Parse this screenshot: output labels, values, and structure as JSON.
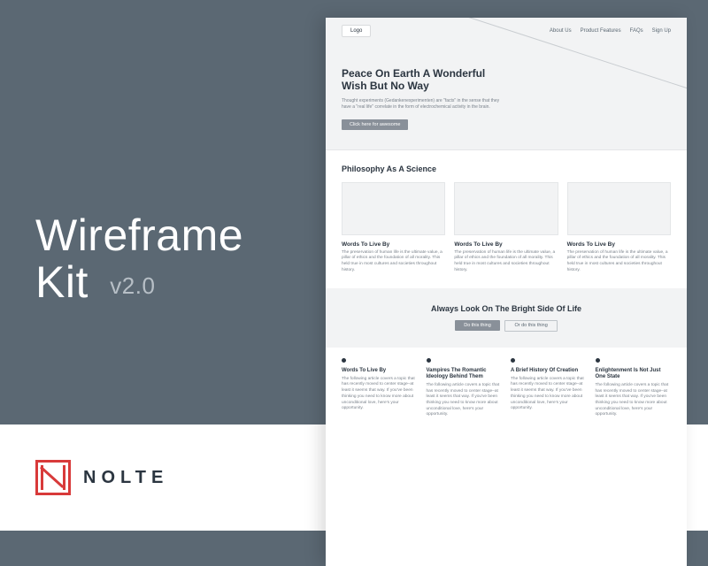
{
  "branding": {
    "title_line1": "Wireframe",
    "title_line2": "Kit",
    "version": "v2.0",
    "brand_word": "NOLTE"
  },
  "mockup": {
    "nav": {
      "logo": "Logo",
      "links": [
        "About Us",
        "Product Features",
        "FAQs",
        "Sign Up"
      ]
    },
    "hero": {
      "heading": "Peace On Earth A Wonderful Wish But No Way",
      "body": "Thought experiments (Gedankenexperimenten) are \"facts\" in the sense that they have a \"real life\" correlate in the form of electrochemical activity in the brain.",
      "cta": "Click here for awesome"
    },
    "section_cards": {
      "heading": "Philosophy As A Science",
      "cards": [
        {
          "title": "Words To Live By",
          "body": "The preservation of human life is the ultimate value, a pillar of ethics and the foundation of all morality. This held true in most cultures and societies throughout history."
        },
        {
          "title": "Words To Live By",
          "body": "The preservation of human life is the ultimate value, a pillar of ethics and the foundation of all morality. This held true in most cultures and societies throughout history."
        },
        {
          "title": "Words To Live By",
          "body": "The preservation of human life is the ultimate value, a pillar of ethics and the foundation of all morality. This held true in most cultures and societies throughout history."
        }
      ]
    },
    "band": {
      "heading": "Always Look On The Bright Side Of Life",
      "btn_primary": "Do this thing",
      "btn_secondary": "Or do this thing"
    },
    "columns": [
      {
        "title": "Words To Live By",
        "body": "The following article covers a topic that has recently moved to center stage–at least it seems that way. If you've been thinking you need to know more about unconditional love, here's your opportunity."
      },
      {
        "title": "Vampires The Romantic Ideology Behind Them",
        "body": "The following article covers a topic that has recently moved to center stage–at least it seems that way. If you've been thinking you need to know more about unconditional love, here's your opportunity."
      },
      {
        "title": "A Brief History Of Creation",
        "body": "The following article covers a topic that has recently moved to center stage–at least it seems that way. If you've been thinking you need to know more about unconditional love, here's your opportunity."
      },
      {
        "title": "Enlightenment Is Not Just One State",
        "body": "The following article covers a topic that has recently moved to center stage–at least it seems that way. If you've been thinking you need to know more about unconditional love, here's your opportunity."
      }
    ]
  }
}
